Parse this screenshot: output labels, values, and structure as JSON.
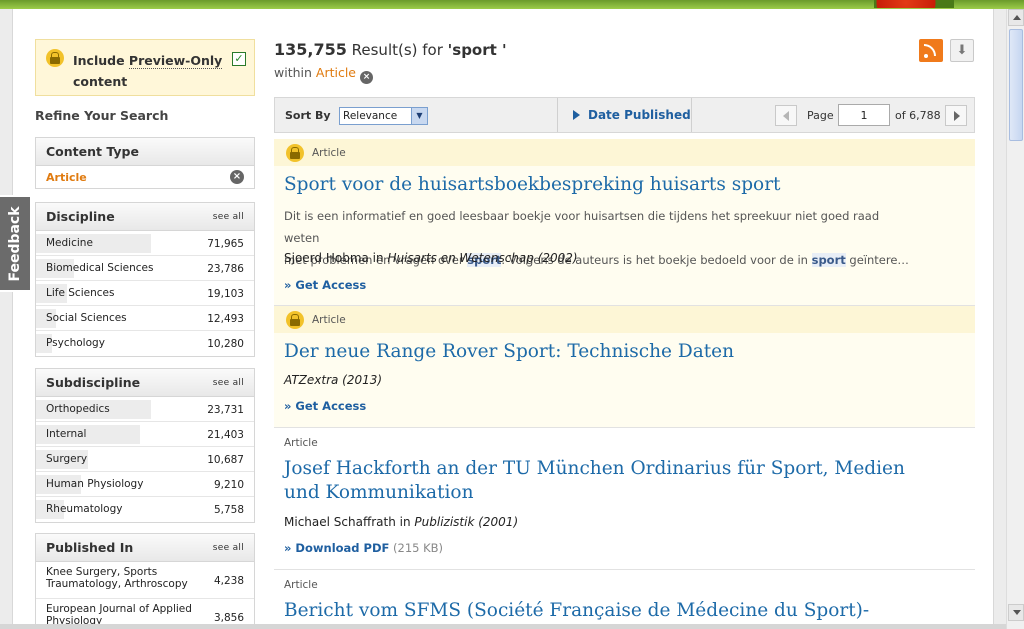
{
  "preview_box": {
    "label_pre": "Include ",
    "label_link": "Preview-Only",
    "label_post": " content",
    "checked": "✓"
  },
  "refine_title": "Refine Your Search",
  "see_all": "see all",
  "content_type": {
    "title": "Content Type",
    "selected": "Article",
    "remove": "×"
  },
  "discipline": {
    "title": "Discipline",
    "items": [
      {
        "name": "Medicine",
        "count": "71,965",
        "share": 1.0
      },
      {
        "name": "Biomedical Sciences",
        "count": "23,786",
        "share": 0.33
      },
      {
        "name": "Life Sciences",
        "count": "19,103",
        "share": 0.27
      },
      {
        "name": "Social Sciences",
        "count": "12,493",
        "share": 0.17
      },
      {
        "name": "Psychology",
        "count": "10,280",
        "share": 0.14
      }
    ]
  },
  "subdiscipline": {
    "title": "Subdiscipline",
    "items": [
      {
        "name": "Orthopedics",
        "count": "23,731",
        "share": 1.0
      },
      {
        "name": "Internal",
        "count": "21,403",
        "share": 0.9
      },
      {
        "name": "Surgery",
        "count": "10,687",
        "share": 0.45
      },
      {
        "name": "Human Physiology",
        "count": "9,210",
        "share": 0.39
      },
      {
        "name": "Rheumatology",
        "count": "5,758",
        "share": 0.24
      }
    ]
  },
  "published_in": {
    "title": "Published In",
    "items": [
      {
        "name": "Knee Surgery, Sports Traumatology, Arthroscopy",
        "count": "4,238"
      },
      {
        "name": "European Journal of Applied Physiology",
        "count": "3,856"
      }
    ]
  },
  "feedback": "Feedback",
  "results": {
    "count": "135,755",
    "label": " Result(s) for ",
    "query": "'sport '",
    "within_label": "within ",
    "within_value": "Article"
  },
  "sort": {
    "label": "Sort By",
    "value": "Relevance",
    "date_published": "Date Published"
  },
  "pagination": {
    "page_label": "Page",
    "page": "1",
    "of_label": "of 6,788"
  },
  "items": [
    {
      "type": "Article",
      "title": "Sport voor de huisartsboekbespreking huisarts sport",
      "snippet_1": "Dit is een informatief en goed leesbaar boekje voor huisartsen die tijdens het spreekuur niet goed raad weten",
      "snippet_2a": "met problemen en vragen over ",
      "snippet_hl1": "sport",
      "snippet_2b": ". Volgens de auteurs is het boekje bedoeld voor de in ",
      "snippet_hl2": "sport",
      "snippet_2c": " geïntere…",
      "author": "Sjoerd Hobma",
      "in": " in ",
      "journal": "Huisarts en Wetenschap (2002)",
      "action": "» Get Access"
    },
    {
      "type": "Article",
      "title": "Der neue Range Rover Sport: Technische Daten",
      "journal": "ATZextra (2013)",
      "action": "» Get Access"
    },
    {
      "type": "Article",
      "title_line1": "Josef Hackforth an der TU München Ordinarius für Sport, Medien",
      "title_line2": "und Kommunikation",
      "author": "Michael Schaffrath",
      "in": " in ",
      "journal": "Publizistik (2001)",
      "action": "» Download PDF",
      "size": " (215 KB)"
    },
    {
      "type": "Article",
      "title": "Bericht vom SFMS (Société Française de Médecine du Sport)-"
    }
  ],
  "colors": {
    "accent_orange": "#e07b10",
    "link_blue": "#1d6aa8",
    "locked_bg": "#fdf6d6"
  }
}
